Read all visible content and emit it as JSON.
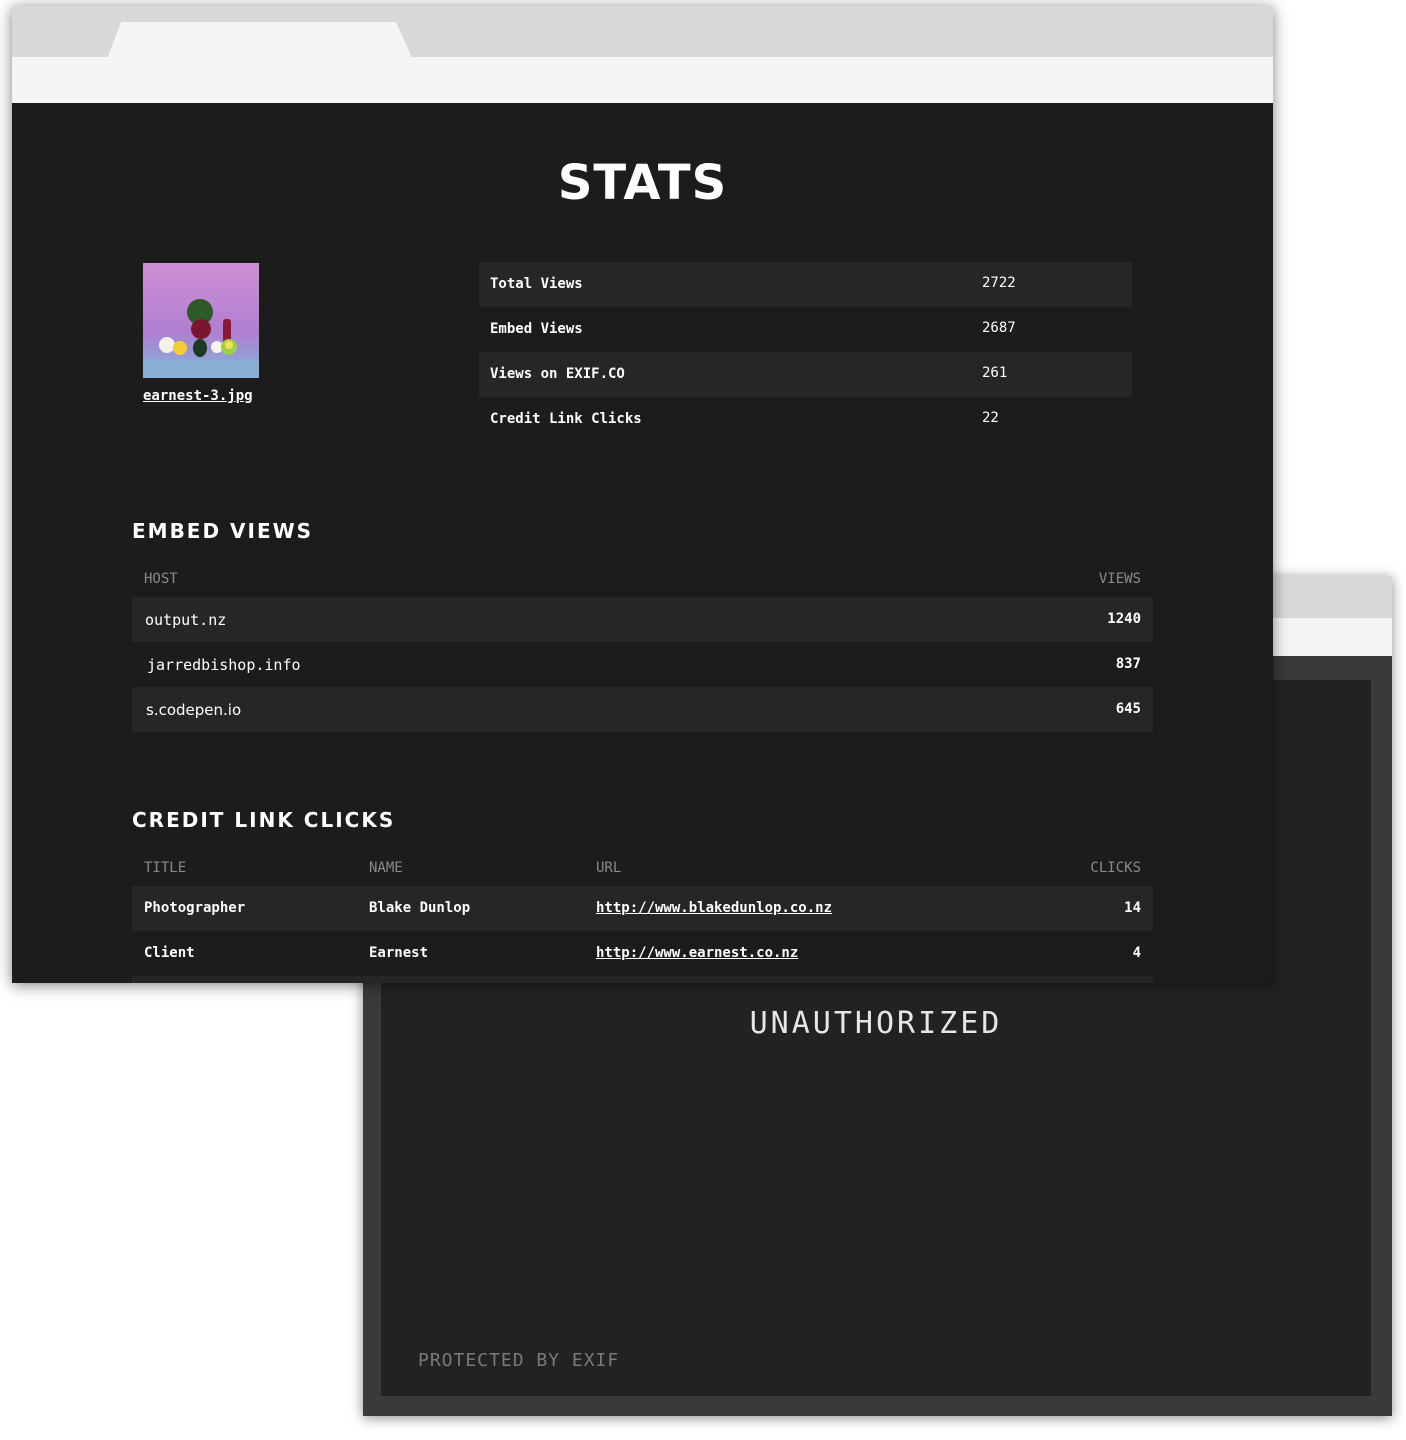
{
  "stats_page": {
    "title": "STATS",
    "image": {
      "filename": "earnest-3.jpg"
    },
    "summary": [
      {
        "label": "Total Views",
        "value": "2722"
      },
      {
        "label": "Embed Views",
        "value": "2687"
      },
      {
        "label": "Views on EXIF.CO",
        "value": "261"
      },
      {
        "label": "Credit Link Clicks",
        "value": "22"
      }
    ],
    "embed_views": {
      "heading": "EMBED VIEWS",
      "columns": {
        "host": "HOST",
        "views": "VIEWS"
      },
      "rows": [
        {
          "host": "output.nz",
          "views": "1240"
        },
        {
          "host": "jarredbishop.info",
          "views": "837"
        },
        {
          "host": "s.codepen.io",
          "views": "645"
        }
      ]
    },
    "credit_link_clicks": {
      "heading": "CREDIT LINK CLICKS",
      "columns": {
        "title": "TITLE",
        "name": "NAME",
        "url": "URL",
        "clicks": "CLICKS"
      },
      "rows": [
        {
          "title": "Photographer",
          "name": "Blake Dunlop",
          "url": "http://www.blakedunlop.co.nz",
          "clicks": "14"
        },
        {
          "title": "Client",
          "name": "Earnest",
          "url": "http://www.earnest.co.nz",
          "clicks": "4"
        }
      ]
    }
  },
  "unauthorized_page": {
    "message": "UNAUTHORIZED",
    "footer": "PROTECTED BY EXIF"
  },
  "colors": {
    "background": "#1c1c1c",
    "row_shade": "#262626",
    "chrome": "#d8d8d8",
    "chrome_bar": "#f5f5f7",
    "text": "#ffffff",
    "muted": "#8a8a8a"
  }
}
